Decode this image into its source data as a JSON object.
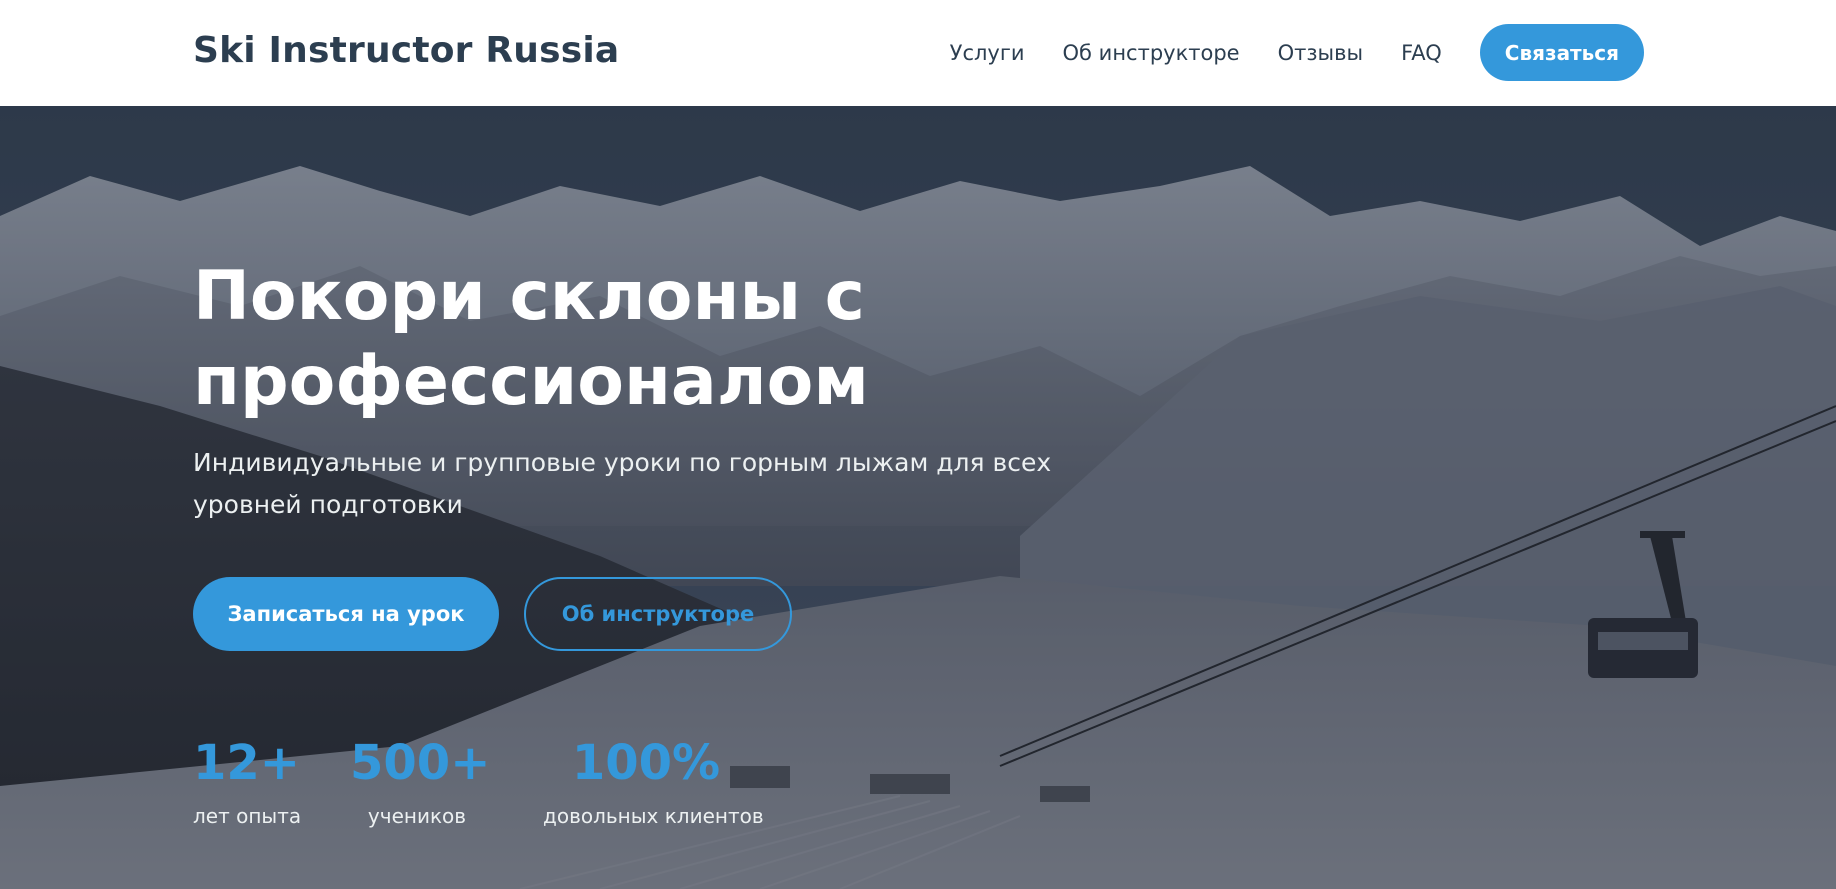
{
  "header": {
    "logo": "Ski Instructor Russia",
    "nav": [
      {
        "label": "Услуги"
      },
      {
        "label": "Об инструкторе"
      },
      {
        "label": "Отзывы"
      },
      {
        "label": "FAQ"
      }
    ],
    "cta_label": "Связаться"
  },
  "hero": {
    "title": "Покори склоны с профессионалом",
    "subtitle": "Индивидуальные и групповые уроки по горным лыжам для всех уровней подготовки",
    "primary_button": "Записаться на урок",
    "secondary_button": "Об инструкторе",
    "stats": [
      {
        "value": "12+",
        "label": "лет опыта"
      },
      {
        "value": "500+",
        "label": "учеников"
      },
      {
        "value": "100%",
        "label": "довольных клиентов"
      }
    ]
  },
  "colors": {
    "accent": "#3498db",
    "text_dark": "#2c3e50",
    "header_bg": "#ffffff"
  }
}
